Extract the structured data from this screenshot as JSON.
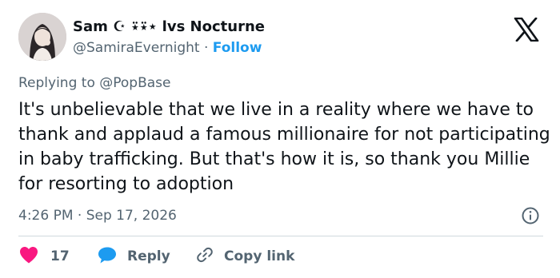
{
  "author": {
    "display_name": "Sam ☪︎ ⍣⍣⋆ lvs Nocturne",
    "handle": "@SamiraEvernight",
    "separator": "·",
    "follow_label": "Follow"
  },
  "reply_to": {
    "prefix": "Replying to",
    "mention": "@PopBase"
  },
  "tweet": {
    "text": "It's unbelievable that we live in a reality where we have to thank and applaud a famous millionaire for not participating in baby trafficking. But that's how it is, so thank you Millie for resorting to adoption",
    "time": "4:26 PM",
    "separator": "·",
    "date": "Sep 17, 2026"
  },
  "actions": {
    "like_count": "17",
    "reply_label": "Reply",
    "copy_link_label": "Copy link"
  },
  "colors": {
    "like": "#f91880",
    "reply": "#1d9bf0",
    "link": "#1d9bf0",
    "muted": "#536471"
  },
  "icons": {
    "platform": "x-logo-icon",
    "info": "info-icon",
    "like": "heart-icon",
    "reply": "speech-bubble-icon",
    "copy_link": "link-icon"
  }
}
